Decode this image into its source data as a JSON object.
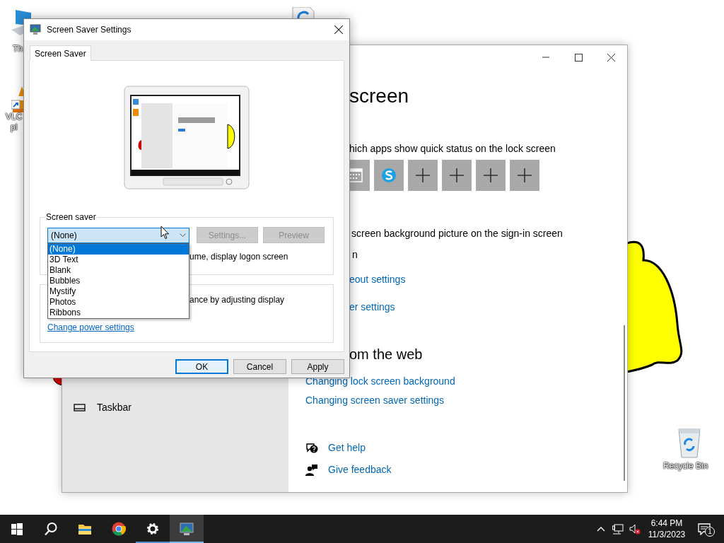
{
  "desktop_icons": [
    {
      "kind": "pc",
      "label_lines": [
        "Th"
      ]
    },
    {
      "kind": "vlc",
      "label_lines": [
        "VLC",
        "pl"
      ]
    },
    {
      "kind": "document"
    },
    {
      "kind": "recycle",
      "label_lines": [
        "Recycle Bin"
      ]
    }
  ],
  "settings_window": {
    "sidebar_items": [
      {
        "kind": "taskbar",
        "label": "Taskbar"
      }
    ],
    "heading": "screen",
    "quick_status_label": "hich apps show quick status on the lock screen",
    "quick_status_tiles": [
      {
        "kind": "calendar"
      },
      {
        "kind": "skype"
      },
      {
        "kind": "add"
      },
      {
        "kind": "add"
      },
      {
        "kind": "add"
      },
      {
        "kind": "add"
      }
    ],
    "sign_in_label": "screen background picture on the sign-in screen",
    "toggle_state": "n",
    "links": [
      "eout settings",
      "er settings"
    ],
    "web_heading": "om the web",
    "web_links": [
      "Changing lock screen background",
      "Changing screen saver settings"
    ],
    "help_links": [
      {
        "kind": "help",
        "label": "Get help"
      },
      {
        "kind": "feedback",
        "label": "Give feedback"
      }
    ]
  },
  "dialog": {
    "title": "Screen Saver Settings",
    "tabs": [
      {
        "label": "Screen Saver",
        "selected": true
      }
    ],
    "group_label": "Screen saver",
    "combo": {
      "value": "(None)",
      "expanded": true
    },
    "options": [
      {
        "label": "(None)",
        "selected": true
      },
      {
        "label": "3D Text",
        "selected": false
      },
      {
        "label": "Blank",
        "selected": false
      },
      {
        "label": "Bubbles",
        "selected": false
      },
      {
        "label": "Mystify",
        "selected": false
      },
      {
        "label": "Photos",
        "selected": false
      },
      {
        "label": "Ribbons",
        "selected": false
      }
    ],
    "buttons": [
      {
        "label": "Settings...",
        "disabled": true
      },
      {
        "label": "Preview",
        "disabled": true
      }
    ],
    "resume_text": "ume, display logon screen",
    "power_text": "ance by adjusting display",
    "power_link": "Change power settings",
    "footer_buttons": [
      {
        "label": "OK",
        "default": true
      },
      {
        "label": "Cancel",
        "default": false
      },
      {
        "label": "Apply",
        "default": false
      }
    ]
  },
  "taskbar": {
    "apps": [
      {
        "kind": "start"
      },
      {
        "kind": "search"
      },
      {
        "kind": "explorer",
        "running": false,
        "active": false
      },
      {
        "kind": "chrome",
        "running": false,
        "active": false
      },
      {
        "kind": "settings",
        "running": true,
        "active": false
      },
      {
        "kind": "screensaver",
        "running": true,
        "active": true
      }
    ],
    "muted": true,
    "time": "6:44 PM",
    "date": "11/3/2023",
    "notification_count": "1"
  }
}
